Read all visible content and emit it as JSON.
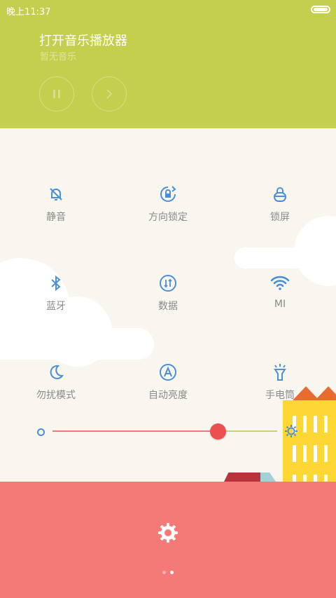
{
  "status": {
    "time": "晚上11:37"
  },
  "music": {
    "title": "打开音乐播放器",
    "subtitle": "暂无音乐"
  },
  "tiles": [
    {
      "label": "静音",
      "icon": "bell-off-icon"
    },
    {
      "label": "方向锁定",
      "icon": "rotation-lock-icon"
    },
    {
      "label": "锁屏",
      "icon": "lock-icon"
    },
    {
      "label": "蓝牙",
      "icon": "bluetooth-icon"
    },
    {
      "label": "数据",
      "icon": "data-icon"
    },
    {
      "label": "MI",
      "icon": "wifi-icon"
    },
    {
      "label": "勿扰模式",
      "icon": "moon-icon"
    },
    {
      "label": "自动亮度",
      "icon": "auto-brightness-icon"
    },
    {
      "label": "手电筒",
      "icon": "flashlight-icon"
    }
  ],
  "brightness": {
    "value": 0.72
  },
  "colors": {
    "top": "#c3cf4d",
    "bottom": "#f37a77",
    "icon_blue": "#4a8fd8",
    "slider_thumb": "#ec4f4f"
  },
  "pager": {
    "count": 2,
    "active": 1
  }
}
